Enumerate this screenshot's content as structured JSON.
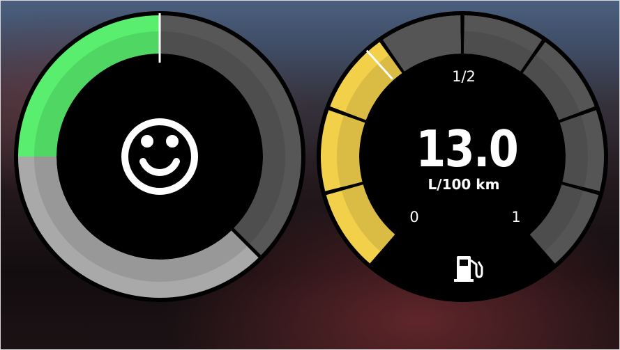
{
  "eco_gauge": {
    "icon": "smiley-face-icon",
    "level_percent": 25,
    "colors": {
      "fill": "#59ee6e",
      "track_light": "#a9a9a9",
      "track_dark": "#575757",
      "needle": "#ffffff"
    }
  },
  "fuel_gauge": {
    "value": "13.0",
    "unit": "L/100 km",
    "scale_labels": {
      "min": "0",
      "mid": "1/2",
      "max": "1"
    },
    "level_fraction": 0.5,
    "icon": "fuel-pump-icon",
    "colors": {
      "fill": "#f2d04a",
      "track": "#555555",
      "needle": "#ffffff"
    }
  }
}
